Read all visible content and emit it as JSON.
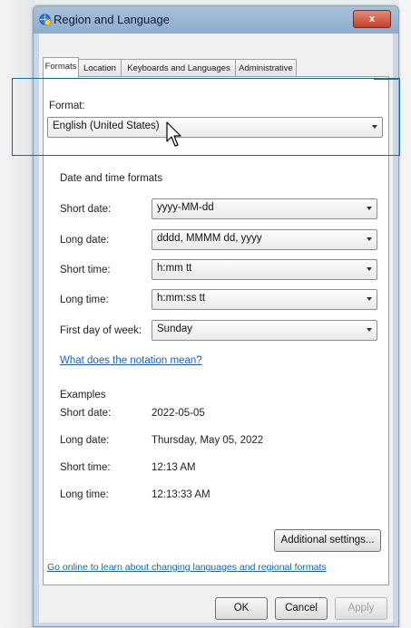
{
  "window": {
    "title": "Region and Language",
    "close_label": "x"
  },
  "tabs": [
    {
      "label": "Formats"
    },
    {
      "label": "Location"
    },
    {
      "label": "Keyboards and Languages"
    },
    {
      "label": "Administrative"
    }
  ],
  "format": {
    "label": "Format:",
    "value": "English (United States)"
  },
  "date_time": {
    "section_label": "Date and time formats",
    "rows": [
      {
        "label": "Short date:",
        "value": "yyyy-MM-dd"
      },
      {
        "label": "Long date:",
        "value": "dddd, MMMM dd, yyyy"
      },
      {
        "label": "Short time:",
        "value": "h:mm tt"
      },
      {
        "label": "Long time:",
        "value": "h:mm:ss tt"
      },
      {
        "label": "First day of week:",
        "value": "Sunday"
      }
    ],
    "notation_link": "What does the notation mean?"
  },
  "examples": {
    "section_label": "Examples",
    "rows": [
      {
        "label": "Short date:",
        "value": "2022-05-05"
      },
      {
        "label": "Long date:",
        "value": "Thursday, May 05, 2022"
      },
      {
        "label": "Short time:",
        "value": "12:13 AM"
      },
      {
        "label": "Long time:",
        "value": "12:13:33 AM"
      }
    ]
  },
  "additional_settings_label": "Additional settings...",
  "online_link": "Go online to learn about changing languages and regional formats",
  "buttons": {
    "ok": "OK",
    "cancel": "Cancel",
    "apply": "Apply"
  },
  "colors": {
    "highlight": "#1a6b8e",
    "link": "#1f5fb0"
  },
  "icons": {
    "title": "globe-clock-icon",
    "cursor": "mouse-pointer-icon"
  }
}
